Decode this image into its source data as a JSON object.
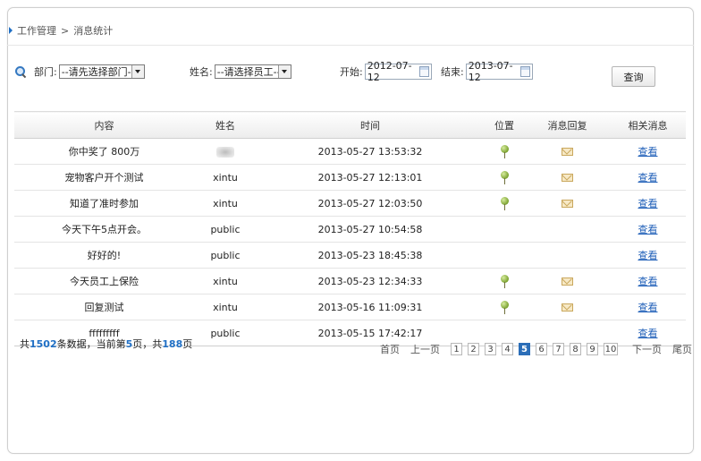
{
  "breadcrumb": {
    "parent": "工作管理",
    "separator": ">",
    "current": "消息统计"
  },
  "filters": {
    "department_label": "部门:",
    "department_value": "--请先选择部门--",
    "name_label": "姓名:",
    "name_value": "--请选择员工--",
    "start_label": "开始:",
    "start_value": "2012-07-12",
    "end_label": "结束:",
    "end_value": "2013-07-12",
    "query_button": "查询"
  },
  "table": {
    "columns": [
      "内容",
      "姓名",
      "时间",
      "位置",
      "消息回复",
      "相关消息"
    ],
    "rows": [
      {
        "content": "你中奖了 800万",
        "name": "",
        "name_blurred": true,
        "time": "2013-05-27 13:53:32",
        "location": true,
        "reply": true,
        "action": "查看"
      },
      {
        "content": "宠物客户开个测试",
        "name": "xintu",
        "time": "2013-05-27 12:13:01",
        "location": true,
        "reply": true,
        "action": "查看"
      },
      {
        "content": "知道了准时参加",
        "name": "xintu",
        "time": "2013-05-27 12:03:50",
        "location": true,
        "reply": true,
        "action": "查看"
      },
      {
        "content": "今天下午5点开会。",
        "name": "public",
        "time": "2013-05-27 10:54:58",
        "location": false,
        "reply": false,
        "action": "查看"
      },
      {
        "content": "好好的!",
        "name": "public",
        "time": "2013-05-23 18:45:38",
        "location": false,
        "reply": false,
        "action": "查看"
      },
      {
        "content": "今天员工上保险",
        "name": "xintu",
        "time": "2013-05-23 12:34:33",
        "location": true,
        "reply": true,
        "action": "查看"
      },
      {
        "content": "回复测试",
        "name": "xintu",
        "time": "2013-05-16 11:09:31",
        "location": true,
        "reply": true,
        "action": "查看"
      },
      {
        "content": "fffffffff",
        "name": "public",
        "time": "2013-05-15 17:42:17",
        "location": false,
        "reply": false,
        "action": "查看"
      }
    ]
  },
  "summary": {
    "prefix": "共",
    "total": "1502",
    "mid1": "条数据，当前第",
    "page": "5",
    "mid2": "页，共",
    "pages": "188",
    "suffix": "页"
  },
  "pager": {
    "first": "首页",
    "prev": "上一页",
    "pages": [
      "1",
      "2",
      "3",
      "4",
      "5",
      "6",
      "7",
      "8",
      "9",
      "10"
    ],
    "active": "5",
    "next": "下一页",
    "last": "尾页"
  },
  "colors": {
    "accent": "#1f6fc5",
    "active_page": "#2b6eb8",
    "link": "#1f5fb8"
  }
}
